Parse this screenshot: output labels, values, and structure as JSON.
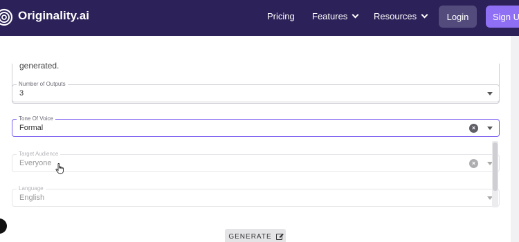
{
  "nav": {
    "brand": "Originality.ai",
    "links": [
      {
        "label": "Pricing",
        "has_dropdown": false
      },
      {
        "label": "Features",
        "has_dropdown": true
      },
      {
        "label": "Resources",
        "has_dropdown": true
      }
    ],
    "login_label": "Login",
    "signup_label": "Sign U",
    "colors": {
      "nav_bg": "#2c2158",
      "signup_bg": "#8f6ff3",
      "login_bg": "#544b7d"
    }
  },
  "form": {
    "textarea_text": "generated.",
    "number_of_outputs": {
      "label": "Number of Outputs",
      "value": "3"
    },
    "tone_of_voice": {
      "label": "Tone Of Voice",
      "value": "Formal"
    },
    "target_audience": {
      "label": "Target Audience",
      "value": "Everyone"
    },
    "language": {
      "label": "Language",
      "value": "English"
    },
    "generate_label": "GENERATE",
    "accent_color": "#7b5cf0"
  }
}
